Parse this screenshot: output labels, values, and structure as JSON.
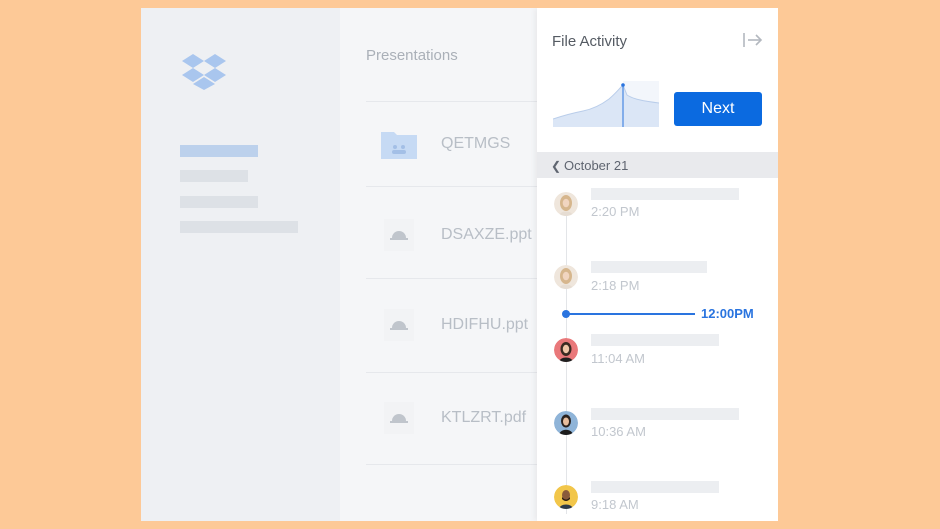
{
  "main": {
    "title": "Presentations",
    "files": [
      {
        "name": "QETMGS",
        "icon": "folder-icon"
      },
      {
        "name": "DSAXZE.ppt",
        "icon": "presentation-file-icon"
      },
      {
        "name": "HDIFHU.ppt",
        "icon": "presentation-file-icon"
      },
      {
        "name": "KTLZRT.pdf",
        "icon": "pdf-file-icon"
      }
    ]
  },
  "panel": {
    "title": "File Activity",
    "next_label": "Next",
    "date_label": "October 21",
    "now_label": "12:00PM",
    "activities": [
      {
        "time": "2:20 PM",
        "avatar": "avatar-blonde-woman"
      },
      {
        "time": "2:18 PM",
        "avatar": "avatar-blonde-woman"
      },
      {
        "time": "11:04 AM",
        "avatar": "avatar-woman-red"
      },
      {
        "time": "10:36 AM",
        "avatar": "avatar-woman-blue"
      },
      {
        "time": "9:18 AM",
        "avatar": "avatar-man-yellow"
      }
    ]
  },
  "colors": {
    "accent": "#0b6ae0",
    "background": "#fdc997",
    "timeline_now": "#2a74df"
  }
}
